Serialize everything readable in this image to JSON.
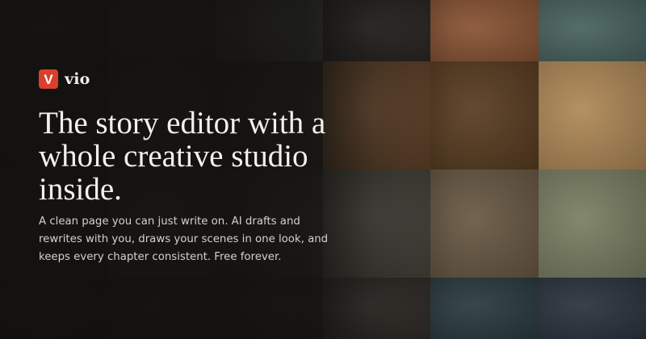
{
  "brand": {
    "logo_letter": "V",
    "name": "vio",
    "logo_color": "#d9402b"
  },
  "hero": {
    "headline": "The story editor with a whole creative studio inside.",
    "subcopy": "A clean page you can just write on. AI drafts and rewrites with you, draws your scenes in one look, and keeps every chapter consistent. Free forever."
  },
  "gallery": {
    "tiles": [
      {
        "name": "forest-painting-tile",
        "bg": "#2b3327"
      },
      {
        "name": "village-scene-tile",
        "bg": "#3c3b2f"
      },
      {
        "name": "snowy-trees-tile",
        "bg": "#4e5544"
      },
      {
        "name": "seated-man-portrait-tile",
        "bg": "#2d2a26"
      },
      {
        "name": "kids-at-market-tile",
        "bg": "#8a5535"
      },
      {
        "name": "jungle-canopy-tile",
        "bg": "#4a6460"
      },
      {
        "name": "dark-forest-tile",
        "bg": "#26261f"
      },
      {
        "name": "thatched-hut-tile",
        "bg": "#3a3329"
      },
      {
        "name": "misty-field-tile",
        "bg": "#30302b"
      },
      {
        "name": "cozy-kitchen-pie-tile",
        "bg": "#6b4a2c"
      },
      {
        "name": "telescope-observatory-tile",
        "bg": "#5a3e22"
      },
      {
        "name": "floating-market-boats-tile",
        "bg": "#b08a58"
      },
      {
        "name": "old-house-tile",
        "bg": "#2f2c26"
      },
      {
        "name": "girl-with-birds-tile",
        "bg": "#45413a"
      },
      {
        "name": "dusk-village-tile",
        "bg": "#3a3530"
      },
      {
        "name": "sailor-on-ship-tile",
        "bg": "#4c4a40"
      },
      {
        "name": "woman-reading-letter-tile",
        "bg": "#6a5a45"
      },
      {
        "name": "gardener-with-orchids-tile",
        "bg": "#7b8064"
      },
      {
        "name": "shadow-forest-tile",
        "bg": "#22231e"
      },
      {
        "name": "dark-branches-tile",
        "bg": "#2c2b26"
      },
      {
        "name": "night-road-tile",
        "bg": "#2a2724"
      },
      {
        "name": "steam-machine-tile",
        "bg": "#34302b"
      },
      {
        "name": "deep-sea-diver-tile",
        "bg": "#2c3c40"
      },
      {
        "name": "astronaut-earth-tile",
        "bg": "#2d3540"
      }
    ]
  }
}
